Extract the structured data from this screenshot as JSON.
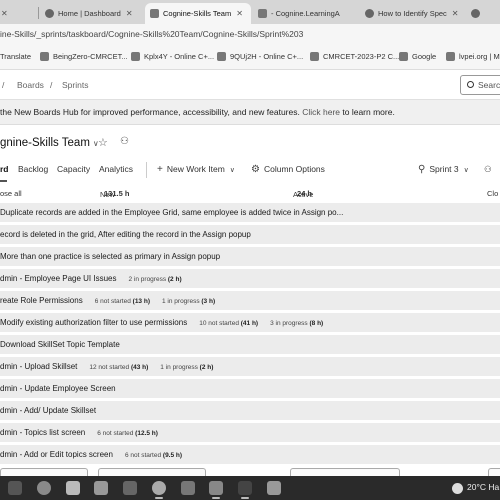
{
  "browser": {
    "tabs": [
      {
        "title": "Home | Dashboard"
      },
      {
        "title": "Cognine-Skills Team"
      },
      {
        "title": "- Cognine.LearningA"
      },
      {
        "title": "How to Identify Spec"
      }
    ],
    "url": "ine-Skills/_sprints/taskboard/Cognine-Skills%20Team/Cognine-Skills/Sprint%203",
    "bookmarks": [
      {
        "label": "Translate"
      },
      {
        "label": "BeingZero-CMRCET..."
      },
      {
        "label": "Kplx4Y - Online C+..."
      },
      {
        "label": "9QUj2H - Online C+..."
      },
      {
        "label": "CMRCET-2023-P2 C..."
      },
      {
        "label": "Google"
      },
      {
        "label": "lvpei.org | Mo"
      }
    ]
  },
  "breadcrumb": {
    "sep1": "/",
    "boards": "Boards",
    "sep2": "/",
    "sprints": "Sprints",
    "search_placeholder": "Search"
  },
  "banner": {
    "text_before": " the New Boards Hub for improved performance, accessibility, and new features.",
    "link": "Click here",
    "text_after": " to learn more."
  },
  "header": {
    "team": "gnine-Skills Team",
    "tabs": {
      "taskboard": "rd",
      "backlog": "Backlog",
      "capacity": "Capacity",
      "analytics": "Analytics"
    },
    "new_work_item": "New Work Item",
    "column_options": "Column Options",
    "sprint": "Sprint 3"
  },
  "columns": {
    "collapse": "ose all",
    "new": {
      "label": "New",
      "hours": "131.5 h"
    },
    "active": {
      "label": "Active",
      "hours": "24 h"
    },
    "closed": "Clo"
  },
  "rows": [
    {
      "title": "Duplicate records are added in the Employee Grid, same employee is added twice in Assign po...",
      "stats": []
    },
    {
      "title": "ecord is deleted in the grid, After editing the record in the Assign popup",
      "stats": []
    },
    {
      "title": "More than one practice is selected as primary in Assign popup",
      "stats": []
    },
    {
      "title": "dmin - Employee Page UI Issues",
      "stats": [
        {
          "text": "2 in progress ",
          "hours": "(2 h)"
        }
      ]
    },
    {
      "title": "reate Role Permissions",
      "stats": [
        {
          "text": "6 not started ",
          "hours": "(13 h)"
        },
        {
          "text": "1 in progress ",
          "hours": "(3 h)"
        }
      ]
    },
    {
      "title": "Modify existing authorization filter to use permissions",
      "stats": [
        {
          "text": "10 not started ",
          "hours": "(41 h)"
        },
        {
          "text": "3 in progress ",
          "hours": "(8 h)"
        }
      ]
    },
    {
      "title": "Download SkillSet Topic Template",
      "stats": []
    },
    {
      "title": "dmin - Upload Skillset",
      "stats": [
        {
          "text": "12 not started ",
          "hours": "(43 h)"
        },
        {
          "text": "1 in progress ",
          "hours": "(2 h)"
        }
      ]
    },
    {
      "title": "dmin - Update Employee Screen",
      "stats": []
    },
    {
      "title": "dmin - Add/ Update Skillset",
      "stats": []
    },
    {
      "title": "dmin - Topics list screen",
      "stats": [
        {
          "text": "6 not started ",
          "hours": "(12.5 h)"
        }
      ]
    },
    {
      "title": "dmin - Add or Edit topics screen",
      "stats": [
        {
          "text": "6 not started ",
          "hours": "(9.5 h)"
        }
      ]
    }
  ],
  "taskbar": {
    "temp": "20°C",
    "weather": "Ha"
  }
}
